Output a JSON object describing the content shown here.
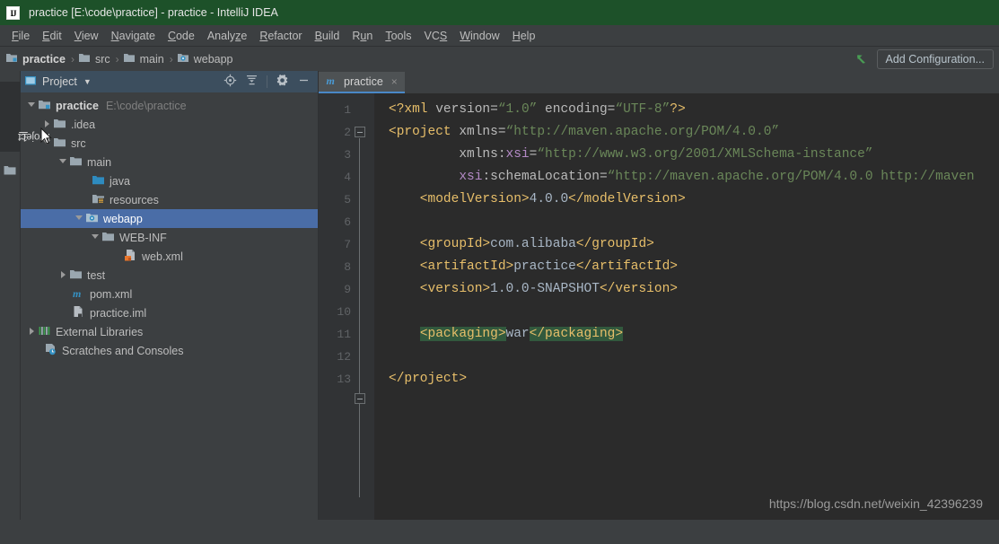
{
  "window": {
    "title": "practice [E:\\code\\practice] - practice - IntelliJ IDEA",
    "logo_text": "IJ"
  },
  "menubar": {
    "items": [
      {
        "label": "File",
        "mnemonic": "F"
      },
      {
        "label": "Edit",
        "mnemonic": "E"
      },
      {
        "label": "View",
        "mnemonic": "V"
      },
      {
        "label": "Navigate",
        "mnemonic": "N"
      },
      {
        "label": "Code",
        "mnemonic": "C"
      },
      {
        "label": "Analyze",
        "mnemonic": "z"
      },
      {
        "label": "Refactor",
        "mnemonic": "R"
      },
      {
        "label": "Build",
        "mnemonic": "B"
      },
      {
        "label": "Run",
        "mnemonic": "u"
      },
      {
        "label": "Tools",
        "mnemonic": "T"
      },
      {
        "label": "VCS",
        "mnemonic": "S"
      },
      {
        "label": "Window",
        "mnemonic": "W"
      },
      {
        "label": "Help",
        "mnemonic": "H"
      }
    ]
  },
  "navbar": {
    "breadcrumbs": [
      {
        "label": "practice",
        "icon": "module-icon"
      },
      {
        "label": "src",
        "icon": "folder-icon"
      },
      {
        "label": "main",
        "icon": "folder-icon"
      },
      {
        "label": "webapp",
        "icon": "webapp-folder-icon"
      }
    ],
    "separator": "›",
    "add_configuration_label": "Add Configuration..."
  },
  "toolstrip": {
    "project_tab_number": "1:",
    "project_tab_label": "Project"
  },
  "project_panel": {
    "title": "Project",
    "tools": [
      "locate-icon",
      "collapse-all-icon",
      "settings-icon",
      "hide-icon"
    ],
    "tree": [
      {
        "label": "practice",
        "sub": "E:\\code\\practice",
        "icon": "module-icon",
        "arrow": "down",
        "indent": 0,
        "bold": true,
        "selected": false
      },
      {
        "label": ".idea",
        "sub": "",
        "icon": "folder-icon",
        "arrow": "right",
        "indent": 1,
        "bold": false,
        "selected": false
      },
      {
        "label": "src",
        "sub": "",
        "icon": "folder-icon",
        "arrow": "down",
        "indent": 1,
        "bold": false,
        "selected": false
      },
      {
        "label": "main",
        "sub": "",
        "icon": "folder-icon",
        "arrow": "down",
        "indent": 2,
        "bold": false,
        "selected": false
      },
      {
        "label": "java",
        "sub": "",
        "icon": "source-folder-icon",
        "arrow": "none",
        "indent": 3,
        "bold": false,
        "selected": false
      },
      {
        "label": "resources",
        "sub": "",
        "icon": "resources-folder-icon",
        "arrow": "none",
        "indent": 3,
        "bold": false,
        "selected": false
      },
      {
        "label": "webapp",
        "sub": "",
        "icon": "webapp-folder-icon",
        "arrow": "down",
        "indent": 3,
        "bold": false,
        "selected": true
      },
      {
        "label": "WEB-INF",
        "sub": "",
        "icon": "folder-icon",
        "arrow": "down",
        "indent": 4,
        "bold": false,
        "selected": false
      },
      {
        "label": "web.xml",
        "sub": "",
        "icon": "web-xml-icon",
        "arrow": "none",
        "indent": 5,
        "bold": false,
        "selected": false
      },
      {
        "label": "test",
        "sub": "",
        "icon": "folder-icon",
        "arrow": "right",
        "indent": 2,
        "bold": false,
        "selected": false
      },
      {
        "label": "pom.xml",
        "sub": "",
        "icon": "maven-icon",
        "arrow": "none",
        "indent": 2,
        "bold": false,
        "selected": false
      },
      {
        "label": "practice.iml",
        "sub": "",
        "icon": "iml-icon",
        "arrow": "none",
        "indent": 2,
        "bold": false,
        "selected": false
      },
      {
        "label": "External Libraries",
        "sub": "",
        "icon": "libraries-icon",
        "arrow": "right",
        "indent": 0,
        "bold": false,
        "selected": false
      },
      {
        "label": "Scratches and Consoles",
        "sub": "",
        "icon": "scratches-icon",
        "arrow": "none",
        "indent": 0,
        "bold": false,
        "selected": false
      }
    ]
  },
  "editor": {
    "tab": {
      "label": "practice",
      "icon": "maven-icon",
      "close": "×"
    },
    "line_numbers": [
      "1",
      "2",
      "3",
      "4",
      "5",
      "6",
      "7",
      "8",
      "9",
      "10",
      "11",
      "12",
      "13"
    ],
    "lines": [
      {
        "n": 1,
        "indent": 0,
        "segments": [
          {
            "t": "<?xml ",
            "c": "tag"
          },
          {
            "t": "version=",
            "c": "attr"
          },
          {
            "t": "“1.0”",
            "c": "str"
          },
          {
            "t": " encoding=",
            "c": "attr"
          },
          {
            "t": "“UTF-8”",
            "c": "str"
          },
          {
            "t": "?>",
            "c": "tag"
          }
        ]
      },
      {
        "n": 2,
        "indent": 0,
        "segments": [
          {
            "t": "<project ",
            "c": "tag"
          },
          {
            "t": "xmlns=",
            "c": "attr"
          },
          {
            "t": "“http://maven.apache.org/POM/4.0.0”",
            "c": "str"
          }
        ]
      },
      {
        "n": 3,
        "indent": 0,
        "segments": [
          {
            "t": "         xmlns:",
            "c": "attr"
          },
          {
            "t": "xsi",
            "c": "ns"
          },
          {
            "t": "=",
            "c": "attr"
          },
          {
            "t": "“http://www.w3.org/2001/XMLSchema-instance”",
            "c": "str"
          }
        ]
      },
      {
        "n": 4,
        "indent": 0,
        "segments": [
          {
            "t": "         ",
            "c": "attr"
          },
          {
            "t": "xsi",
            "c": "ns"
          },
          {
            "t": ":schemaLocation=",
            "c": "attr"
          },
          {
            "t": "“http://maven.apache.org/POM/4.0.0 http://maven",
            "c": "str"
          }
        ]
      },
      {
        "n": 5,
        "indent": 0,
        "segments": [
          {
            "t": "    <modelVersion>",
            "c": "tag"
          },
          {
            "t": "4.0.0",
            "c": "txt"
          },
          {
            "t": "</modelVersion>",
            "c": "tag"
          }
        ]
      },
      {
        "n": 6,
        "indent": 0,
        "segments": []
      },
      {
        "n": 7,
        "indent": 0,
        "segments": [
          {
            "t": "    <groupId>",
            "c": "tag"
          },
          {
            "t": "com.alibaba",
            "c": "txt"
          },
          {
            "t": "</groupId>",
            "c": "tag"
          }
        ]
      },
      {
        "n": 8,
        "indent": 0,
        "segments": [
          {
            "t": "    <artifactId>",
            "c": "tag"
          },
          {
            "t": "practice",
            "c": "txt"
          },
          {
            "t": "</artifactId>",
            "c": "tag"
          }
        ]
      },
      {
        "n": 9,
        "indent": 0,
        "segments": [
          {
            "t": "    <version>",
            "c": "tag"
          },
          {
            "t": "1.0.0-SNAPSHOT",
            "c": "txt"
          },
          {
            "t": "</version>",
            "c": "tag"
          }
        ]
      },
      {
        "n": 10,
        "indent": 0,
        "segments": []
      },
      {
        "n": 11,
        "indent": 0,
        "segments": [
          {
            "t": "    ",
            "c": "txt"
          },
          {
            "t": "<packaging>",
            "c": "tag hl"
          },
          {
            "t": "war",
            "c": "txt"
          },
          {
            "t": "</packaging>",
            "c": "tag hl"
          }
        ]
      },
      {
        "n": 12,
        "indent": 0,
        "segments": []
      },
      {
        "n": 13,
        "indent": 0,
        "segments": [
          {
            "t": "</project>",
            "c": "tag"
          }
        ]
      }
    ]
  },
  "watermark": {
    "text": "https://blog.csdn.net/weixin_42396239"
  },
  "colors": {
    "titlebar_bg": "#1d5129",
    "chrome_bg": "#3c3f41",
    "panel_header_bg": "#3c4e5e",
    "selection_blue": "#4a6da7",
    "editor_bg": "#2b2b2b",
    "gutter_bg": "#313335",
    "tab_accent": "#4a88c7",
    "xml_tag": "#e8bf6a",
    "xml_string": "#6a8759",
    "xml_text": "#a9b7c6",
    "xml_ns": "#b389c5",
    "search_highlight": "#32593d",
    "run_arrow_green": "#499c54"
  }
}
